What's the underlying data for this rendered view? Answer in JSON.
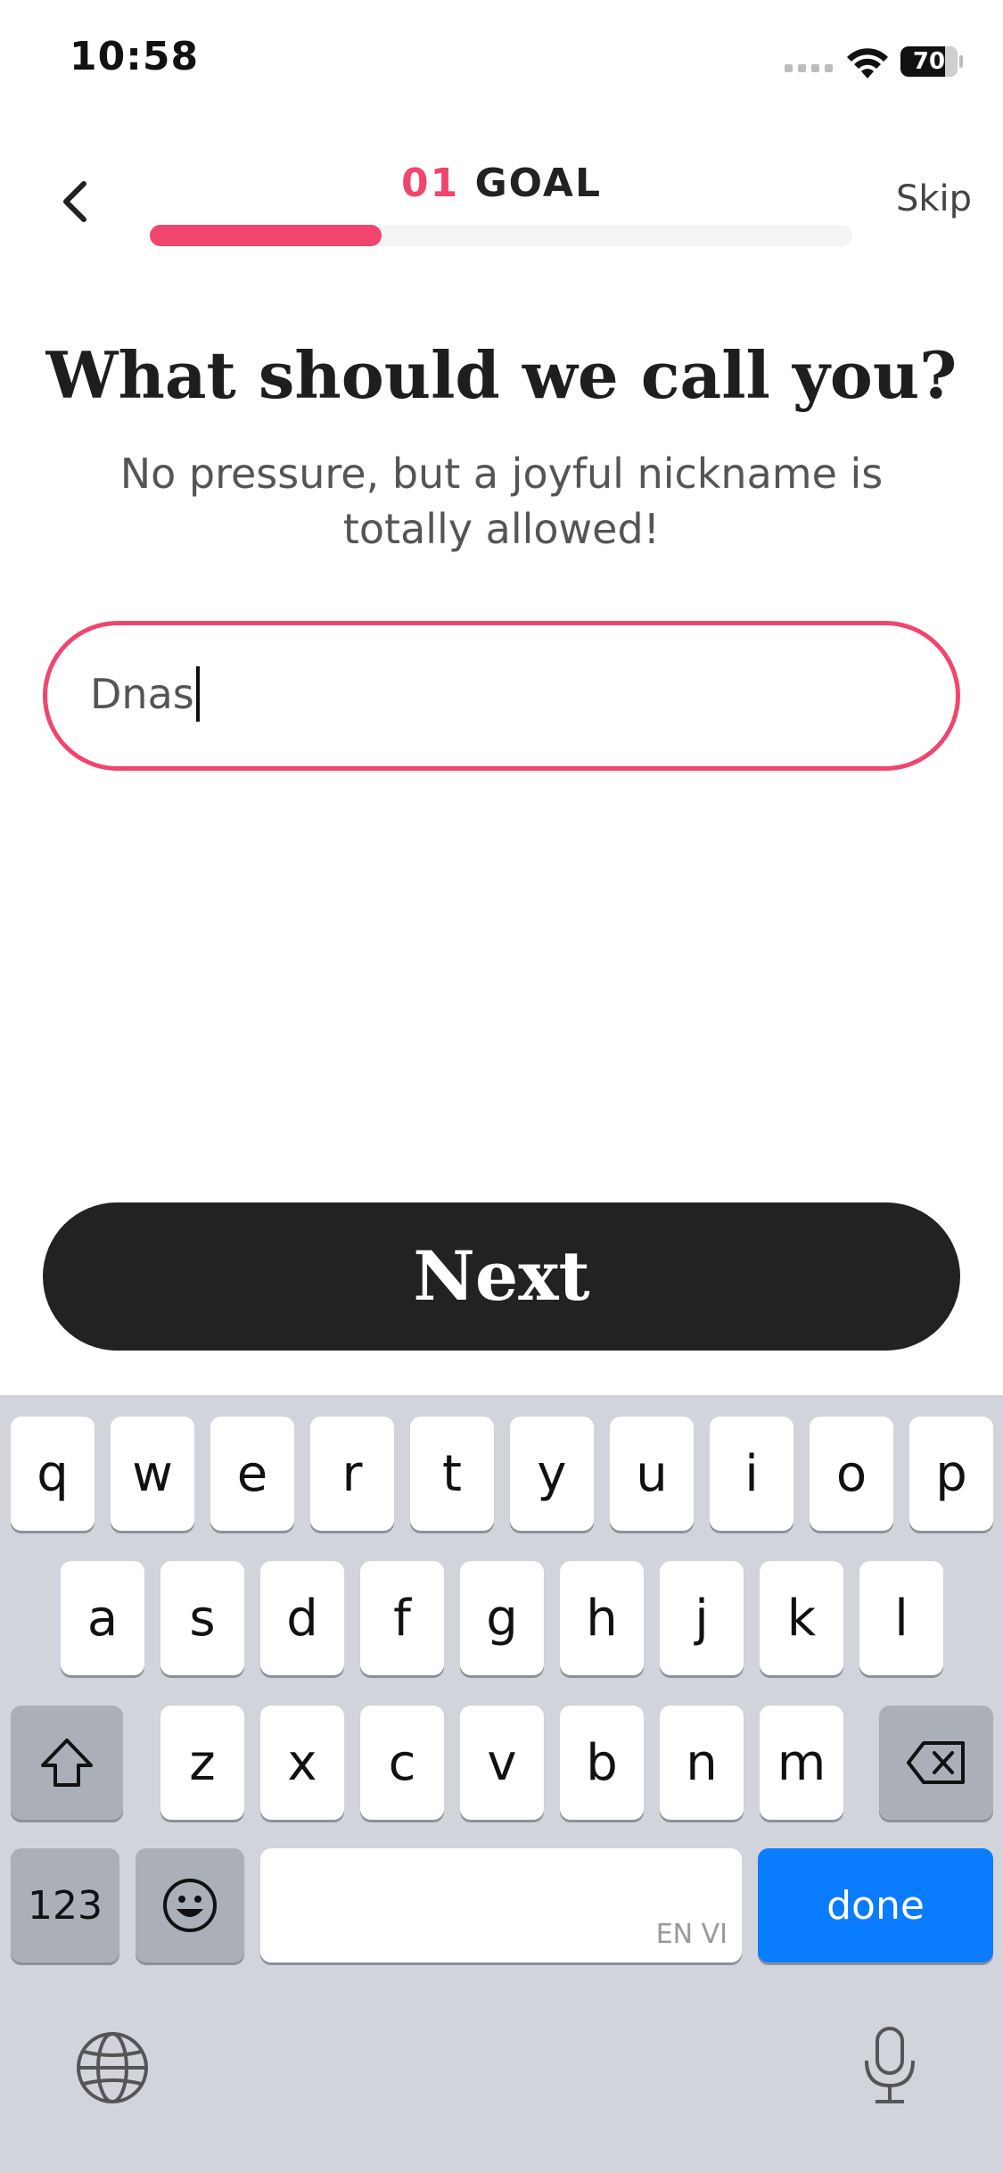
{
  "status_bar": {
    "time": "10:58",
    "battery": "70",
    "icons": [
      "cellular-signal-icon",
      "wifi-icon",
      "battery-icon"
    ]
  },
  "header": {
    "back_icon": "chevron-left-icon",
    "step_number": "01",
    "step_name": "GOAL",
    "skip_label": "Skip",
    "progress": 0.33,
    "accent_color": "#f0466e"
  },
  "question": {
    "title": "What should we call you?",
    "subtitle": "No pressure, but a joyful nickname is totally allowed!"
  },
  "name_input": {
    "value": "Dnas"
  },
  "next_button": {
    "label": "Next",
    "color": "#222222"
  },
  "keyboard": {
    "row1": [
      "q",
      "w",
      "e",
      "r",
      "t",
      "y",
      "u",
      "i",
      "o",
      "p"
    ],
    "row2": [
      "a",
      "s",
      "d",
      "f",
      "g",
      "h",
      "j",
      "k",
      "l"
    ],
    "row3": [
      "z",
      "x",
      "c",
      "v",
      "b",
      "n",
      "m"
    ],
    "numbers_key": "123",
    "space_hint": "EN VI",
    "done_key": "done",
    "done_color": "#0a7cff",
    "icons": [
      "shift-icon",
      "backspace-icon",
      "emoji-icon",
      "globe-icon",
      "microphone-icon"
    ]
  }
}
